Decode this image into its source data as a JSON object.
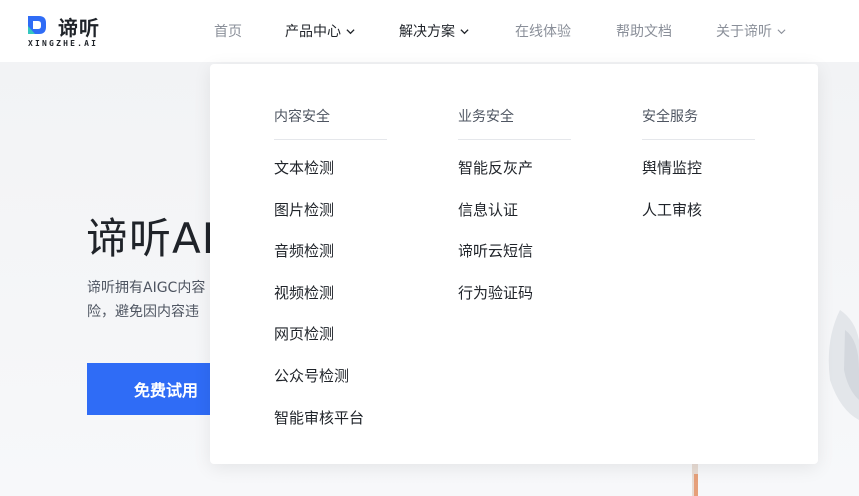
{
  "brand": {
    "name": "谛听",
    "sub": "XINGZHE.AI",
    "color": "#2f6cf6"
  },
  "nav": [
    {
      "label": "首页",
      "has_chevron": false
    },
    {
      "label": "产品中心",
      "has_chevron": true
    },
    {
      "label": "解决方案",
      "has_chevron": true
    },
    {
      "label": "在线体验",
      "has_chevron": false
    },
    {
      "label": "帮助文档",
      "has_chevron": false
    },
    {
      "label": "关于谛听",
      "has_chevron": true
    }
  ],
  "hero": {
    "title": "谛听AI",
    "desc_line1": "谛听拥有AIGC内容",
    "desc_line2": "险，避免因内容违",
    "button": "免费试用"
  },
  "dropdown": {
    "columns": [
      {
        "title": "内容安全",
        "items": [
          "文本检测",
          "图片检测",
          "音频检测",
          "视频检测",
          "网页检测",
          "公众号检测",
          "智能审核平台"
        ]
      },
      {
        "title": "业务安全",
        "items": [
          "智能反灰产",
          "信息认证",
          "谛听云短信",
          "行为验证码"
        ]
      },
      {
        "title": "安全服务",
        "items": [
          "舆情监控",
          "人工审核"
        ]
      }
    ]
  }
}
